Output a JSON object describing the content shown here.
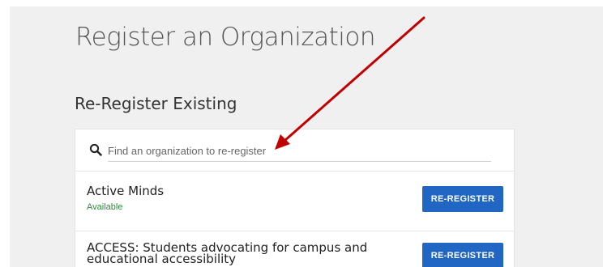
{
  "page": {
    "title": "Register an Organization",
    "section_title": "Re-Register Existing"
  },
  "search": {
    "icon": "search-icon",
    "placeholder": "Find an organization to re-register",
    "value": ""
  },
  "organizations": [
    {
      "name": "Active Minds",
      "status": "Available",
      "button_label": "RE-REGISTER"
    },
    {
      "name": "ACCESS: Students advocating for campus and educational accessibility",
      "status": "",
      "button_label": "RE-REGISTER"
    }
  ],
  "colors": {
    "background": "#f0f0f0",
    "button": "#2166c2",
    "status_available": "#2e8b3a",
    "annotation_arrow": "#c00000"
  }
}
